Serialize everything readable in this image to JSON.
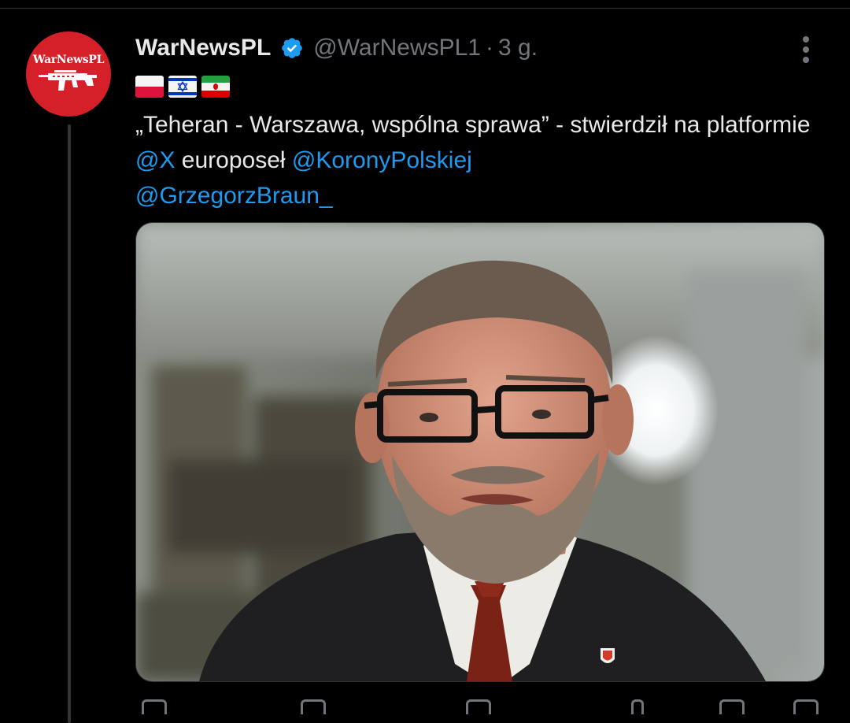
{
  "tweet": {
    "author": {
      "name": "WarNewsPL",
      "handle": "@WarNewsPL1",
      "avatar_text": "WarNewsPL",
      "verified": true
    },
    "separator": "·",
    "time": "3 g.",
    "flags": [
      "poland-flag",
      "israel-flag",
      "iran-flag"
    ],
    "text": {
      "part1": "„Teheran - Warszawa, wspólna sprawa” - stwierdził na platformie ",
      "mention1": "@X",
      "part2": " europoseł ",
      "mention2": "@KoronyPolskiej",
      "mention3": "@GrzegorzBraun_"
    }
  },
  "colors": {
    "background": "#000000",
    "text": "#e7e9ea",
    "muted": "#71767b",
    "link": "#1d9bf0",
    "verified": "#1d9bf0",
    "avatar_bg": "#d5202a"
  },
  "icons": [
    "verified-badge-icon",
    "more-options-icon",
    "rifle-logo-icon"
  ]
}
